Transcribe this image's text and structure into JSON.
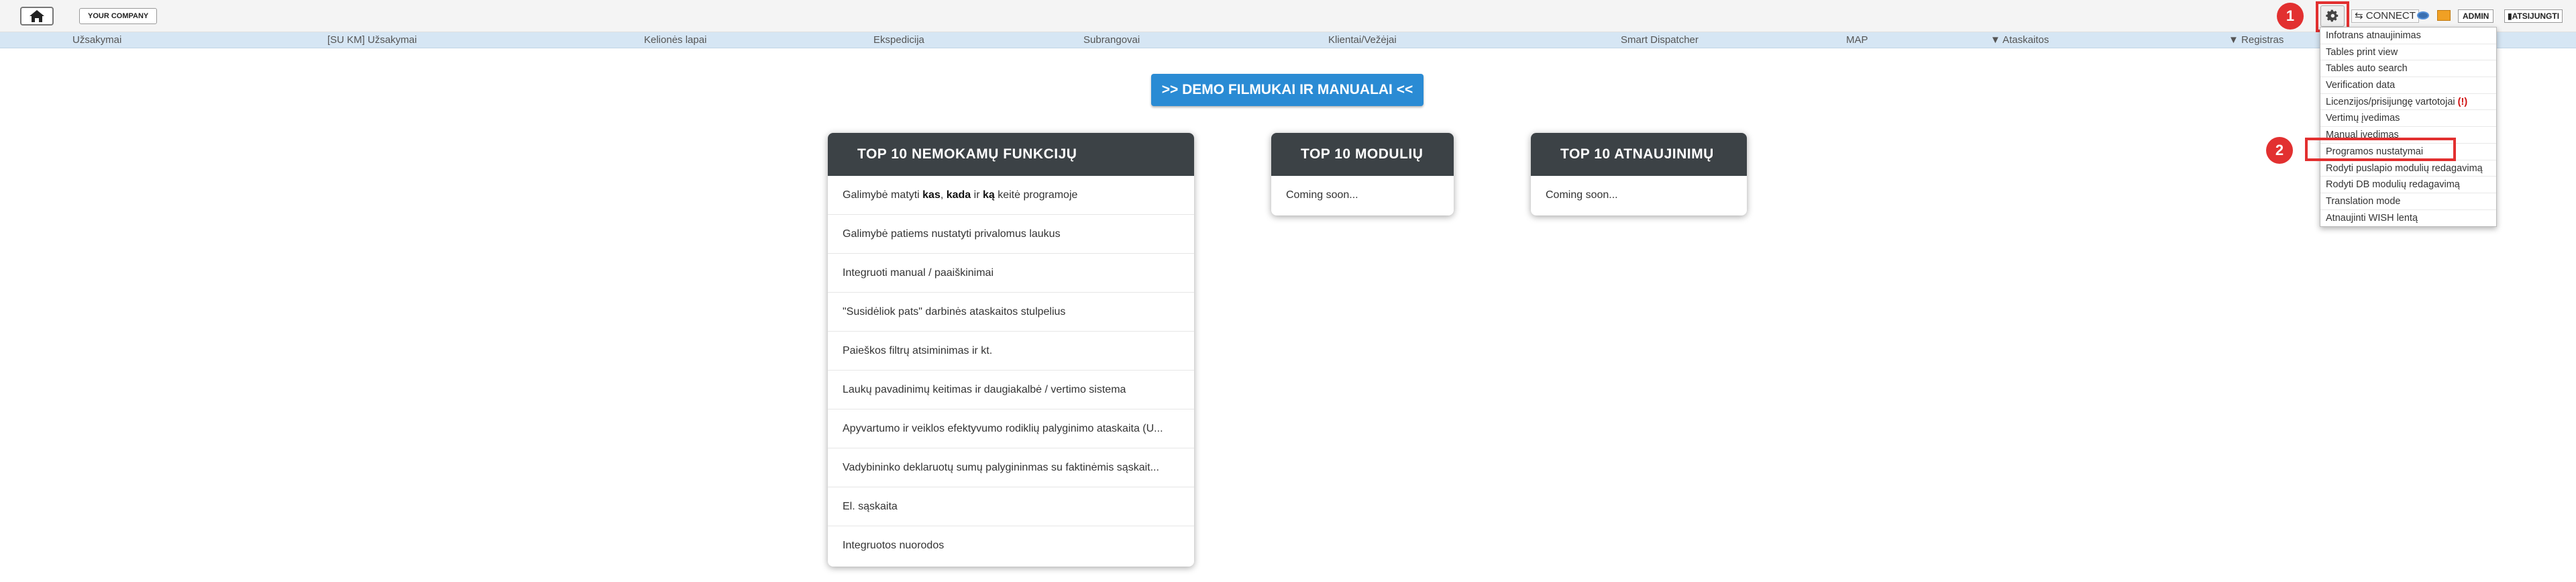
{
  "topbar": {
    "home_icon": "home-icon",
    "company_label": "YOUR COMPANY",
    "gear_icon": "gear-icon",
    "connect_label": "⇆ CONNECT",
    "eye_icon": "eye-icon",
    "mail_icon": "mail-icon",
    "admin_label": "ADMIN",
    "logout_label": "▮ATSIJUNGTI"
  },
  "nav": {
    "items": [
      {
        "label": "Užsakymai"
      },
      {
        "label": "[SU KM] Užsakymai"
      },
      {
        "label": "Kelionės lapai"
      },
      {
        "label": "Ekspedicija"
      },
      {
        "label": "Subrangovai"
      },
      {
        "label": "Klientai/Vežėjai"
      },
      {
        "label": "Smart Dispatcher"
      },
      {
        "label": "MAP"
      },
      {
        "label": "▼ Ataskaitos"
      },
      {
        "label": "▼ Registras"
      }
    ]
  },
  "demo_button": ">> DEMO FILMUKAI IR MANUALAI <<",
  "cards": {
    "functions": {
      "title": "TOP 10 NEMOKAMŲ FUNKCIJŲ",
      "row1_pre": "Galimybė matyti ",
      "row1_b1": "kas",
      "row1_mid1": ", ",
      "row1_b2": "kada",
      "row1_mid2": " ir ",
      "row1_b3": "ką",
      "row1_post": " keitė programoje",
      "rows": [
        "Galimybė patiems nustatyti privalomus laukus",
        "Integruoti manual / paaiškinimai",
        "\"Susidėliok pats\" darbinės ataskaitos stulpelius",
        "Paieškos filtrų atsiminimas ir kt.",
        "Laukų pavadinimų keitimas ir daugiakalbė / vertimo sistema",
        "Apyvartumo ir veiklos efektyvumo rodiklių palyginimo ataskaita (U...",
        "Vadybininko deklaruotų sumų palygininmas su faktinėmis sąskait...",
        "El. sąskaita",
        "Integruotos nuorodos"
      ]
    },
    "modules": {
      "title": "TOP 10 MODULIŲ",
      "row": "Coming soon..."
    },
    "updates": {
      "title": "TOP 10 ATNAUJINIMŲ",
      "row": "Coming soon..."
    }
  },
  "dropdown": {
    "items": [
      "Infotrans atnaujinimas",
      "Tables print view",
      "Tables auto search",
      "Verification data",
      "Licenzijos/prisijungę vartotojai",
      "Vertimų įvedimas",
      "Manual įvedimas",
      "Programos nustatymai",
      "Rodyti puslapio modulių redagavimą",
      "Rodyti DB modulių redagavimą",
      "Translation mode",
      "Atnaujinti WISH lentą"
    ],
    "licenses_warn": "(!)"
  },
  "badges": {
    "one": "1",
    "two": "2"
  },
  "colors": {
    "accent": "#2a8bd4",
    "card_header": "#3c4246",
    "highlight": "#e23030",
    "nav_bg": "#d6e6f4"
  }
}
